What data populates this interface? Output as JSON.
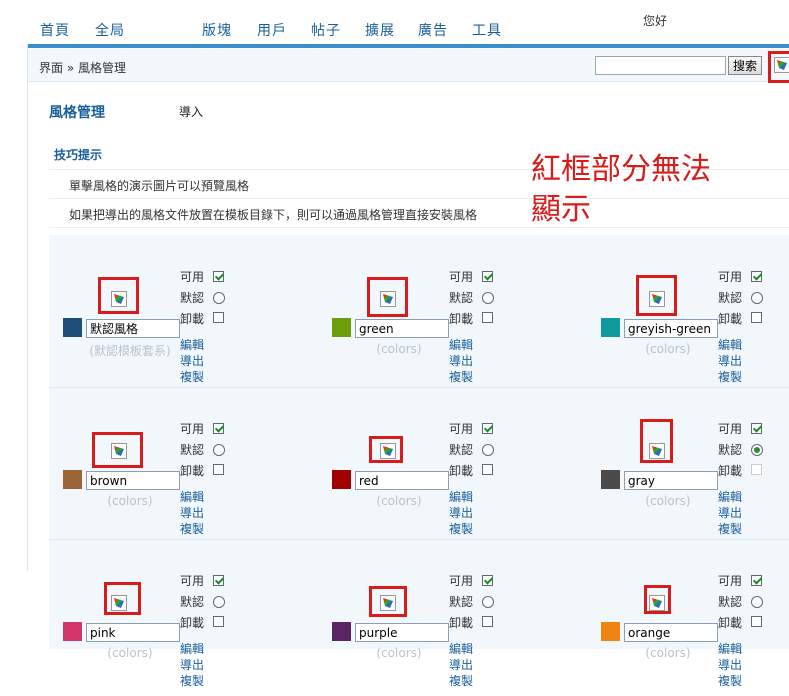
{
  "nav": {
    "items": [
      "首頁",
      "全局",
      "版塊",
      "用戶",
      "帖子",
      "擴展",
      "廣告",
      "工具"
    ],
    "greeting": "您好"
  },
  "breadcrumb": "界面 » 風格管理",
  "search": {
    "value": "",
    "button": "搜索"
  },
  "page": {
    "title": "風格管理",
    "import": "導入"
  },
  "tips": {
    "title": "技巧提示",
    "items": [
      "單擊風格的演示圖片可以預覽風格",
      "如果把導出的風格文件放置在模板目錄下，則可以通過風格管理直接安裝風格"
    ]
  },
  "annotation": {
    "line1": "紅框部分無法",
    "line2": "顯示"
  },
  "labels": {
    "enable": "可用",
    "default": "默認",
    "uninstall": "卸載",
    "edit": "編輯",
    "export": "導出",
    "copy": "複製"
  },
  "styles": [
    {
      "name": "默認風格",
      "sub": "(默認模板套系)",
      "color": "#1f4e79",
      "enabled": true,
      "default": false,
      "uninstall_disabled": false
    },
    {
      "name": "green",
      "sub": "(colors)",
      "color": "#6b9e0a",
      "enabled": true,
      "default": false,
      "uninstall_disabled": false
    },
    {
      "name": "greyish-green",
      "sub": "(colors)",
      "color": "#0f9aa0",
      "enabled": true,
      "default": false,
      "uninstall_disabled": false
    },
    {
      "name": "brown",
      "sub": "(colors)",
      "color": "#9a6434",
      "enabled": true,
      "default": false,
      "uninstall_disabled": false
    },
    {
      "name": "red",
      "sub": "(colors)",
      "color": "#a00000",
      "enabled": true,
      "default": false,
      "uninstall_disabled": false
    },
    {
      "name": "gray",
      "sub": "(colors)",
      "color": "#4b4b4b",
      "enabled": true,
      "default": true,
      "uninstall_disabled": true
    },
    {
      "name": "pink",
      "sub": "(colors)",
      "color": "#d1376a",
      "enabled": true,
      "default": false,
      "uninstall_disabled": false
    },
    {
      "name": "purple",
      "sub": "(colors)",
      "color": "#5b2463",
      "enabled": true,
      "default": false,
      "uninstall_disabled": false
    },
    {
      "name": "orange",
      "sub": "(colors)",
      "color": "#f08311",
      "enabled": true,
      "default": false,
      "uninstall_disabled": false
    }
  ]
}
